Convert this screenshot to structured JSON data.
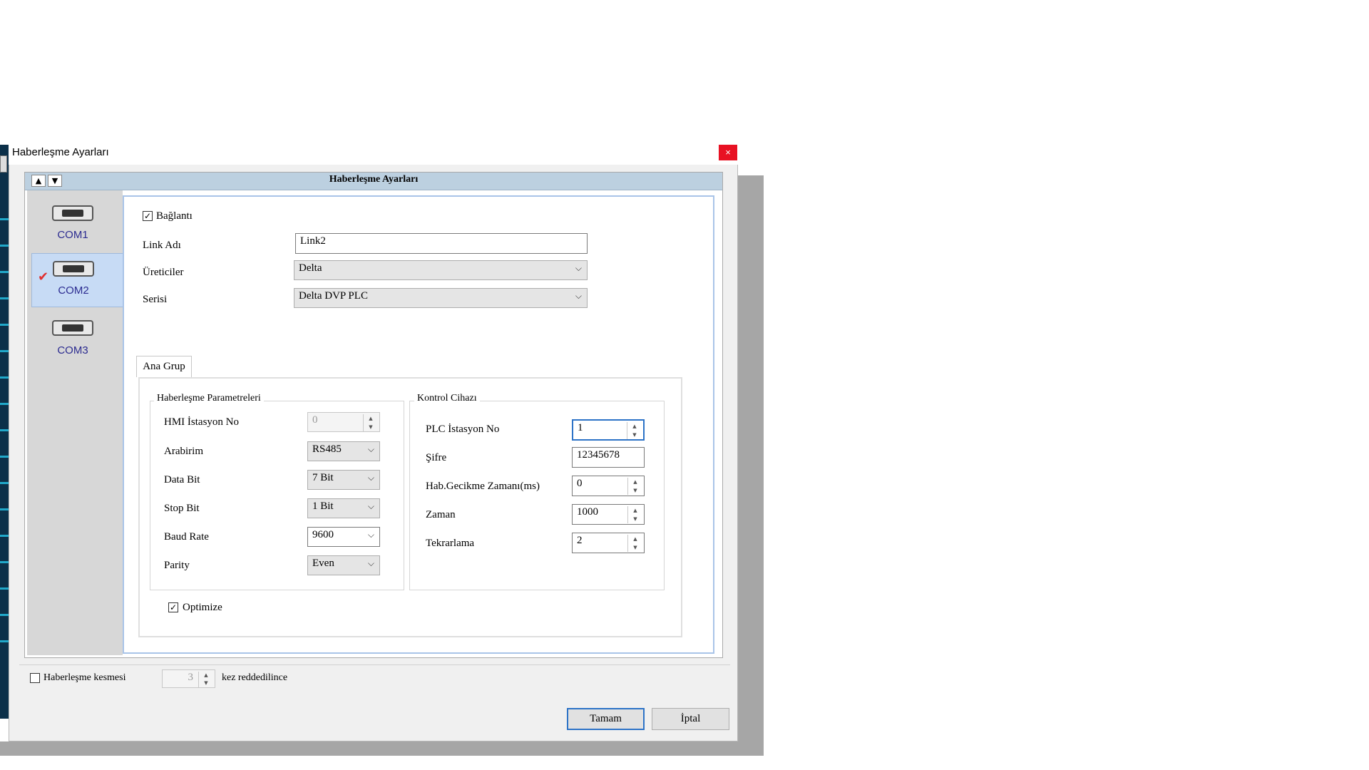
{
  "dialog": {
    "title": "Haberleşme Ayarları",
    "close_glyph": "×",
    "header_title": "Haberleşme Ayarları"
  },
  "nav": {
    "up_icon": "triangle-up-icon",
    "down_icon": "triangle-down-icon"
  },
  "ports": [
    {
      "label": "COM1",
      "selected": false
    },
    {
      "label": "COM2",
      "selected": true
    },
    {
      "label": "COM3",
      "selected": false
    }
  ],
  "connection": {
    "enabled_label": "Bağlantı",
    "enabled": true,
    "link_name_label": "Link Adı",
    "link_name_value": "Link2",
    "manufacturer_label": "Üreticiler",
    "manufacturer_value": "Delta",
    "series_label": "Serisi",
    "series_value": "Delta DVP PLC"
  },
  "tab": {
    "label": "Ana Grup"
  },
  "comm_params": {
    "title": "Haberleşme Parametreleri",
    "hmi_station_label": "HMI İstasyon No",
    "hmi_station_value": "0",
    "interface_label": "Arabirim",
    "interface_value": "RS485",
    "data_bit_label": "Data Bit",
    "data_bit_value": "7 Bit",
    "stop_bit_label": "Stop Bit",
    "stop_bit_value": "1 Bit",
    "baud_rate_label": "Baud Rate",
    "baud_rate_value": "9600",
    "parity_label": "Parity",
    "parity_value": "Even"
  },
  "controller": {
    "title": "Kontrol Cihazı",
    "plc_station_label": "PLC İstasyon No",
    "plc_station_value": "1",
    "password_label": "Şifre",
    "password_value": "12345678",
    "delay_label": "Hab.Gecikme Zamanı(ms)",
    "delay_value": "0",
    "time_label": "Zaman",
    "time_value": "1000",
    "retry_label": "Tekrarlama",
    "retry_value": "2"
  },
  "optimize": {
    "label": "Optimize",
    "checked": true
  },
  "footer": {
    "break_label": "Haberleşme kesmesi",
    "break_checked": false,
    "break_count": "3",
    "suffix": "kez reddedilince",
    "ok_label": "Tamam",
    "cancel_label": "İptal"
  }
}
